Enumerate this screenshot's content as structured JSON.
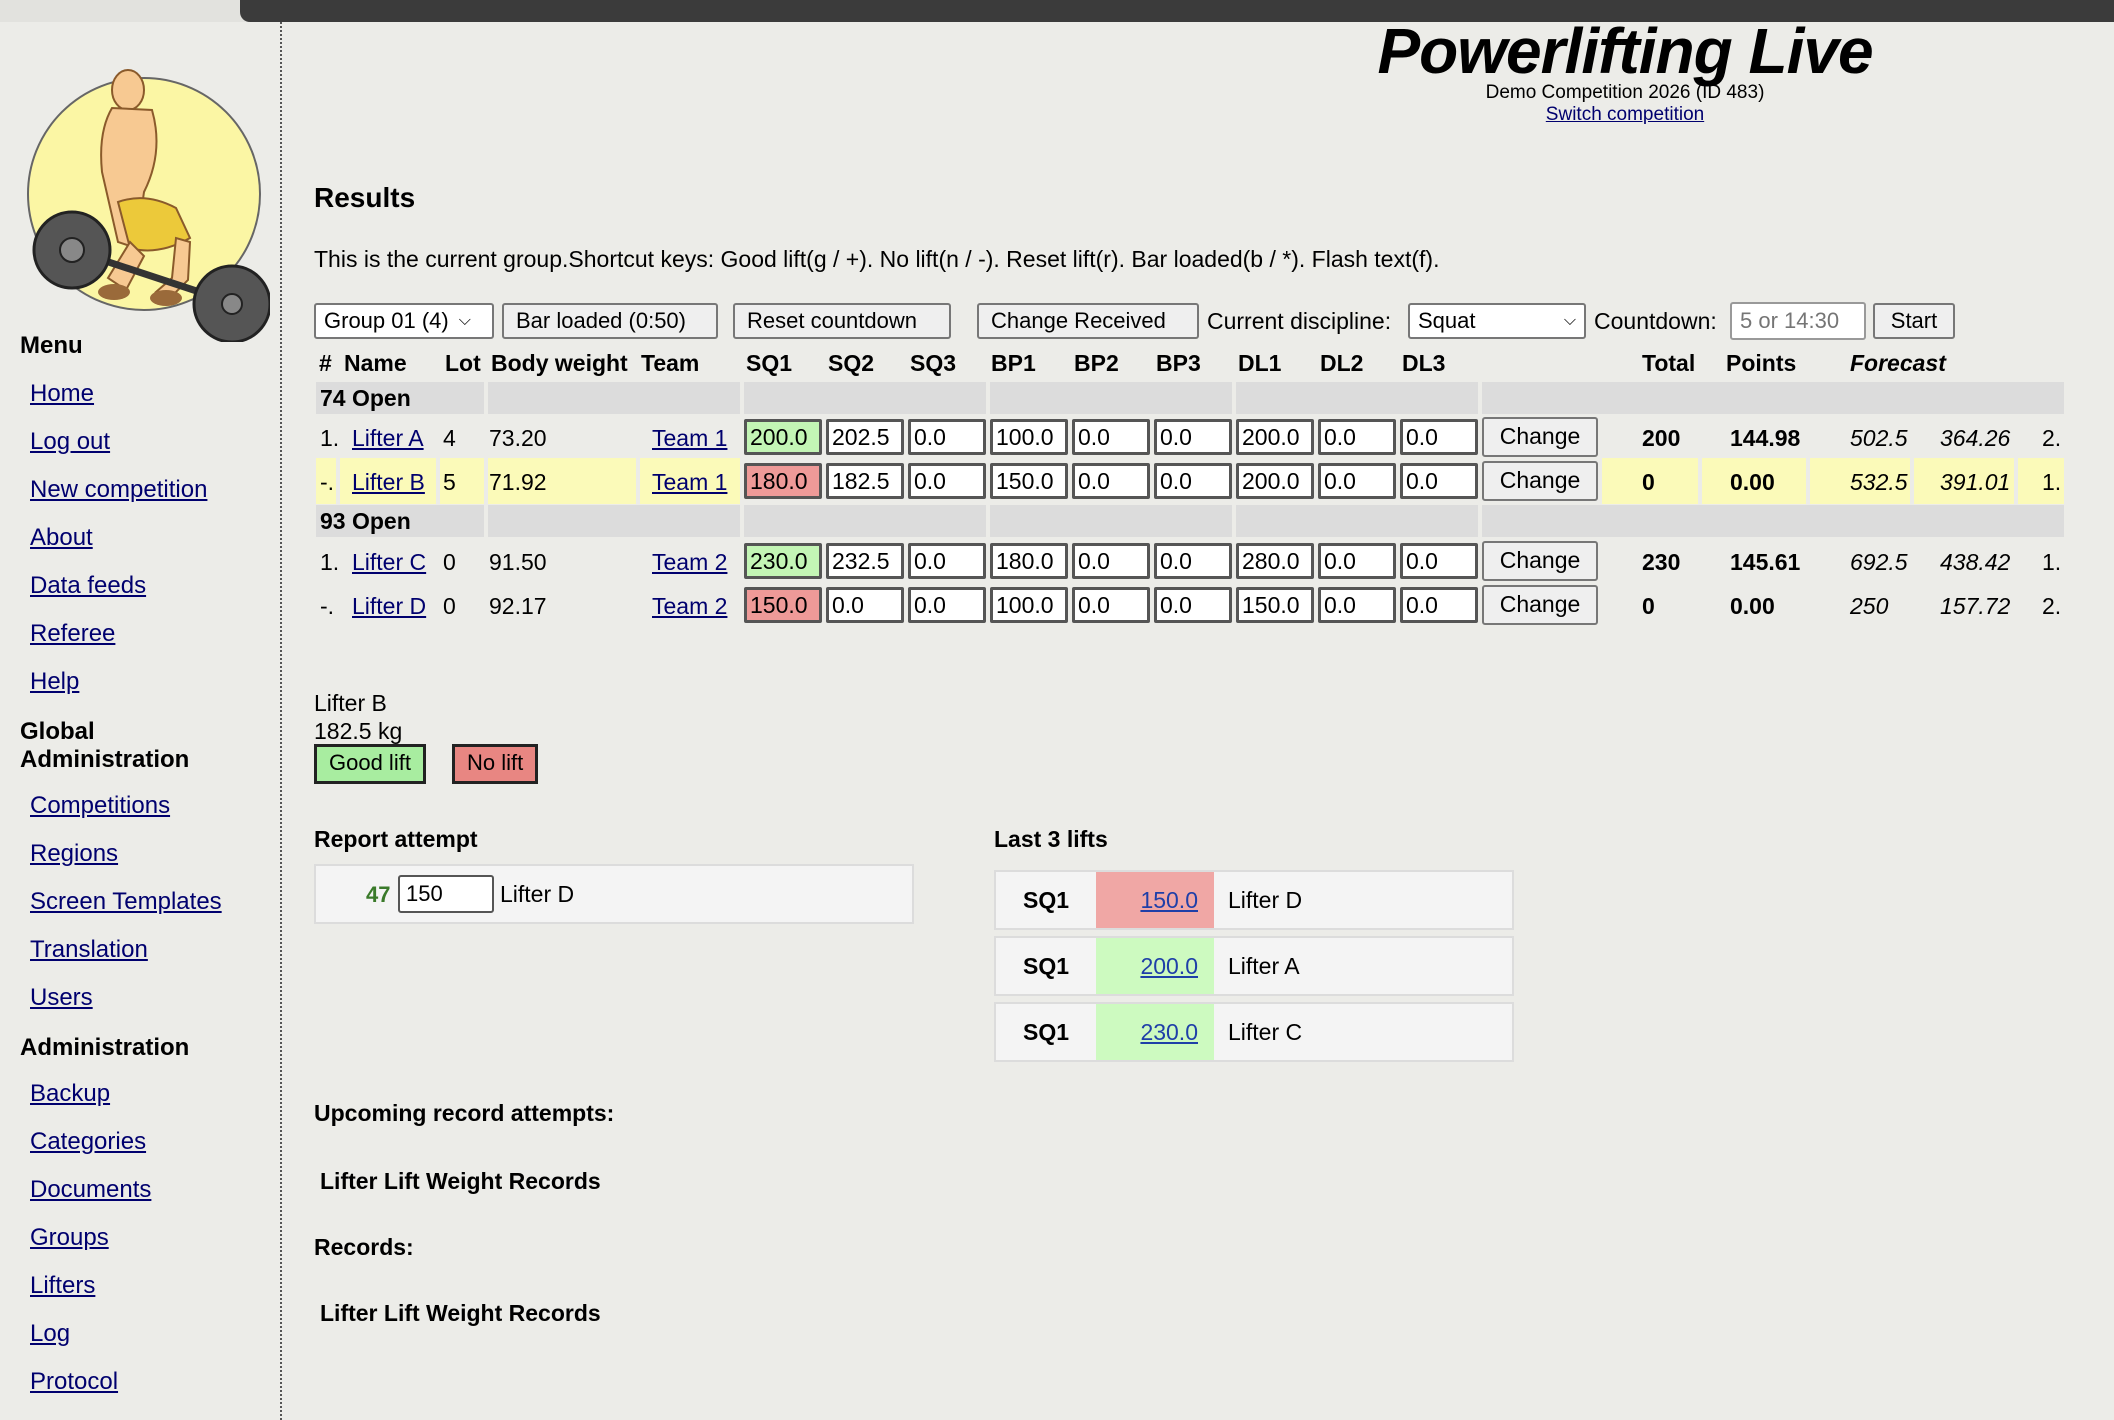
{
  "header": {
    "title": "Powerlifting Live",
    "competition": "Demo Competition 2026 (ID 483)",
    "switch_link": "Switch competition"
  },
  "sidebar": {
    "menu_heading": "Menu",
    "menu_items": [
      "Home",
      "Log out",
      "New competition",
      "About",
      "Data feeds",
      "Referee",
      "Help"
    ],
    "global_heading": "Global Administration",
    "global_items": [
      "Competitions",
      "Regions",
      "Screen Templates",
      "Translation",
      "Users"
    ],
    "admin_heading": "Administration",
    "admin_items": [
      "Backup",
      "Categories",
      "Documents",
      "Groups",
      "Lifters",
      "Log",
      "Protocol"
    ]
  },
  "results": {
    "title": "Results",
    "instructions": "This is the current group.Shortcut keys: Good lift(g / +). No lift(n / -). Reset lift(r). Bar loaded(b / *). Flash text(f)."
  },
  "controls": {
    "group_select": "Group 01 (4)",
    "bar_loaded": "Bar loaded (0:50)",
    "reset_countdown": "Reset countdown",
    "change_received": "Change Received",
    "discipline_label": "Current discipline:",
    "discipline_value": "Squat",
    "countdown_label": "Countdown:",
    "countdown_placeholder": "5 or 14:30",
    "start": "Start"
  },
  "table": {
    "headers": {
      "place": "#",
      "name": "Name",
      "lot": "Lot",
      "bodyweight": "Body weight",
      "team": "Team",
      "sq1": "SQ1",
      "sq2": "SQ2",
      "sq3": "SQ3",
      "bp1": "BP1",
      "bp2": "BP2",
      "bp3": "BP3",
      "dl1": "DL1",
      "dl2": "DL2",
      "dl3": "DL3",
      "total": "Total",
      "points": "Points",
      "forecast": "Forecast"
    },
    "change_label": "Change",
    "categories": [
      {
        "name": "74 Open",
        "lifters": [
          {
            "place": "1.",
            "name": "Lifter A",
            "lot": "4",
            "bodyweight": "73.20",
            "team": "Team 1",
            "attempts": [
              "200.0",
              "202.5",
              "0.0",
              "100.0",
              "0.0",
              "0.0",
              "200.0",
              "0.0",
              "0.0"
            ],
            "total": "200",
            "points": "144.98",
            "forecast_total": "502.5",
            "forecast_points": "364.26",
            "forecast_place": "2."
          },
          {
            "place": "-.",
            "name": "Lifter B",
            "lot": "5",
            "bodyweight": "71.92",
            "team": "Team 1",
            "attempts": [
              "180.0",
              "182.5",
              "0.0",
              "150.0",
              "0.0",
              "0.0",
              "200.0",
              "0.0",
              "0.0"
            ],
            "total": "0",
            "points": "0.00",
            "forecast_total": "532.5",
            "forecast_points": "391.01",
            "forecast_place": "1."
          }
        ]
      },
      {
        "name": "93 Open",
        "lifters": [
          {
            "place": "1.",
            "name": "Lifter C",
            "lot": "0",
            "bodyweight": "91.50",
            "team": "Team 2",
            "attempts": [
              "230.0",
              "232.5",
              "0.0",
              "180.0",
              "0.0",
              "0.0",
              "280.0",
              "0.0",
              "0.0"
            ],
            "total": "230",
            "points": "145.61",
            "forecast_total": "692.5",
            "forecast_points": "438.42",
            "forecast_place": "1."
          },
          {
            "place": "-.",
            "name": "Lifter D",
            "lot": "0",
            "bodyweight": "92.17",
            "team": "Team 2",
            "attempts": [
              "150.0",
              "0.0",
              "0.0",
              "100.0",
              "0.0",
              "0.0",
              "150.0",
              "0.0",
              "0.0"
            ],
            "total": "0",
            "points": "0.00",
            "forecast_total": "250",
            "forecast_points": "157.72",
            "forecast_place": "2."
          }
        ]
      }
    ]
  },
  "current_attempt": {
    "lifter": "Lifter B",
    "weight": "182.5 kg",
    "good_label": "Good lift",
    "no_label": "No lift"
  },
  "report_attempt": {
    "title": "Report attempt",
    "number": "47",
    "weight": "150",
    "lifter": "Lifter D"
  },
  "last_lifts": {
    "title": "Last 3 lifts",
    "items": [
      {
        "discipline": "SQ1",
        "weight": "150.0",
        "lifter": "Lifter D",
        "result": "bad"
      },
      {
        "discipline": "SQ1",
        "weight": "200.0",
        "lifter": "Lifter A",
        "result": "good"
      },
      {
        "discipline": "SQ1",
        "weight": "230.0",
        "lifter": "Lifter C",
        "result": "good"
      }
    ]
  },
  "records": {
    "upcoming_title": "Upcoming record attempts:",
    "upcoming_columns": "Lifter Lift Weight Records",
    "records_title": "Records:",
    "records_columns": "Lifter Lift Weight Records"
  },
  "colors": {
    "good": "#c3f5b5",
    "bad": "#ee9a98",
    "highlight_row": "#fbfab9",
    "link": "#00006e"
  }
}
